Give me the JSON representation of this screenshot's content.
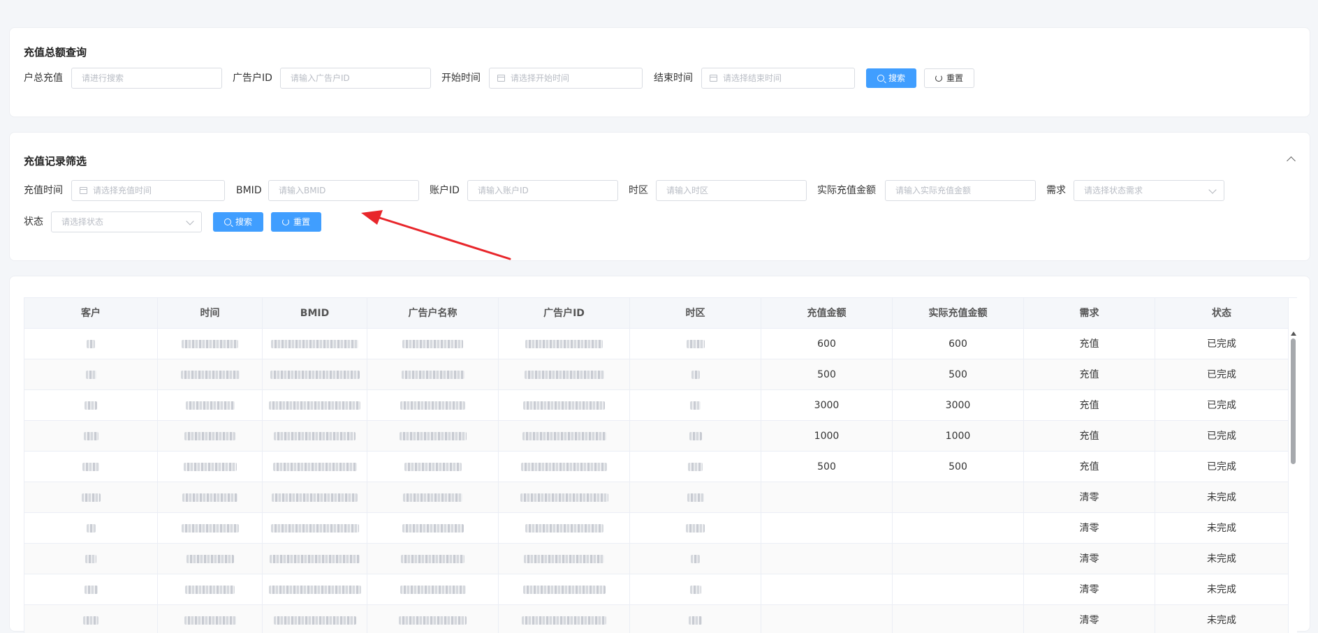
{
  "total_query": {
    "title": "充值总额查询",
    "fields": [
      {
        "label": "户总充值",
        "placeholder": "请进行搜索"
      },
      {
        "label": "广告户ID",
        "placeholder": "请输入广告户ID"
      },
      {
        "label": "开始时间",
        "placeholder": "请选择开始时间"
      },
      {
        "label": "结束时间",
        "placeholder": "请选择结束时间"
      }
    ],
    "search_label": "搜索",
    "reset_label": "重置"
  },
  "record_filter": {
    "title": "充值记录筛选",
    "fields": [
      {
        "label": "充值时间",
        "placeholder": "请选择充值时间"
      },
      {
        "label": "BMID",
        "placeholder": "请输入BMID"
      },
      {
        "label": "账户ID",
        "placeholder": "请输入账户ID"
      },
      {
        "label": "时区",
        "placeholder": "请输入时区"
      },
      {
        "label": "实际充值金额",
        "placeholder": "请输入实际充值金额"
      },
      {
        "label": "需求",
        "placeholder": "请选择状态需求"
      },
      {
        "label": "状态",
        "placeholder": "请选择状态"
      }
    ],
    "search_label": "搜索",
    "reset_label": "重置"
  },
  "table": {
    "columns": [
      "客户",
      "时间",
      "BMID",
      "广告户名称",
      "广告户ID",
      "时区",
      "充值金额",
      "实际充值金额",
      "需求",
      "状态"
    ],
    "rows": [
      {
        "amount": "600",
        "actual": "600",
        "demand": "充值",
        "status": "已完成"
      },
      {
        "amount": "500",
        "actual": "500",
        "demand": "充值",
        "status": "已完成"
      },
      {
        "amount": "3000",
        "actual": "3000",
        "demand": "充值",
        "status": "已完成"
      },
      {
        "amount": "1000",
        "actual": "1000",
        "demand": "充值",
        "status": "已完成"
      },
      {
        "amount": "500",
        "actual": "500",
        "demand": "充值",
        "status": "已完成"
      },
      {
        "amount": "",
        "actual": "",
        "demand": "清零",
        "status": "未完成"
      },
      {
        "amount": "",
        "actual": "",
        "demand": "清零",
        "status": "未完成"
      },
      {
        "amount": "",
        "actual": "",
        "demand": "清零",
        "status": "未完成"
      },
      {
        "amount": "",
        "actual": "",
        "demand": "清零",
        "status": "未完成"
      },
      {
        "amount": "",
        "actual": "",
        "demand": "清零",
        "status": "未完成"
      }
    ]
  },
  "colors": {
    "primary": "#409eff",
    "annotation_arrow": "#e8262b"
  }
}
